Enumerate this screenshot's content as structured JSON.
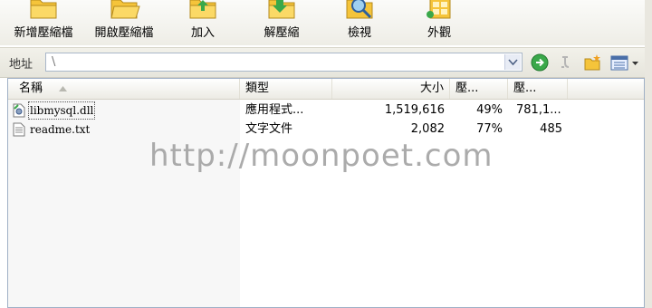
{
  "toolbar": {
    "buttons": [
      {
        "label": "新增壓縮檔",
        "icon": "new-archive-folder-icon"
      },
      {
        "label": "開啟壓縮檔",
        "icon": "open-archive-folder-icon"
      },
      {
        "label": "加入",
        "icon": "add-folder-icon"
      },
      {
        "label": "解壓縮",
        "icon": "extract-folder-icon"
      },
      {
        "label": "檢視",
        "icon": "view-magnifier-icon"
      },
      {
        "label": "外觀",
        "icon": "appearance-icon"
      }
    ]
  },
  "address": {
    "label": "地址",
    "value": "\\",
    "nav_icons": [
      "go-forward-icon",
      "up-level-icon",
      "new-folder-icon",
      "view-mode-icon"
    ]
  },
  "columns": {
    "name": "名稱",
    "type": "類型",
    "size": "大小",
    "ratio": "壓...",
    "packed": "壓..."
  },
  "files": [
    {
      "name": "libmysql.dll",
      "type": "應用程式...",
      "size": "1,519,616",
      "ratio": "49%",
      "packed": "781,1...",
      "icon": "dll-file-icon",
      "selected": true
    },
    {
      "name": "readme.txt",
      "type": "文字文件",
      "size": "2,082",
      "ratio": "77%",
      "packed": "485",
      "icon": "text-file-icon",
      "selected": false
    }
  ],
  "watermark": "http://moonpoet.com",
  "colors": {
    "folder_yellow": "#f5c43a",
    "go_green": "#3aa84a",
    "header_bg": "#ecebe4"
  }
}
